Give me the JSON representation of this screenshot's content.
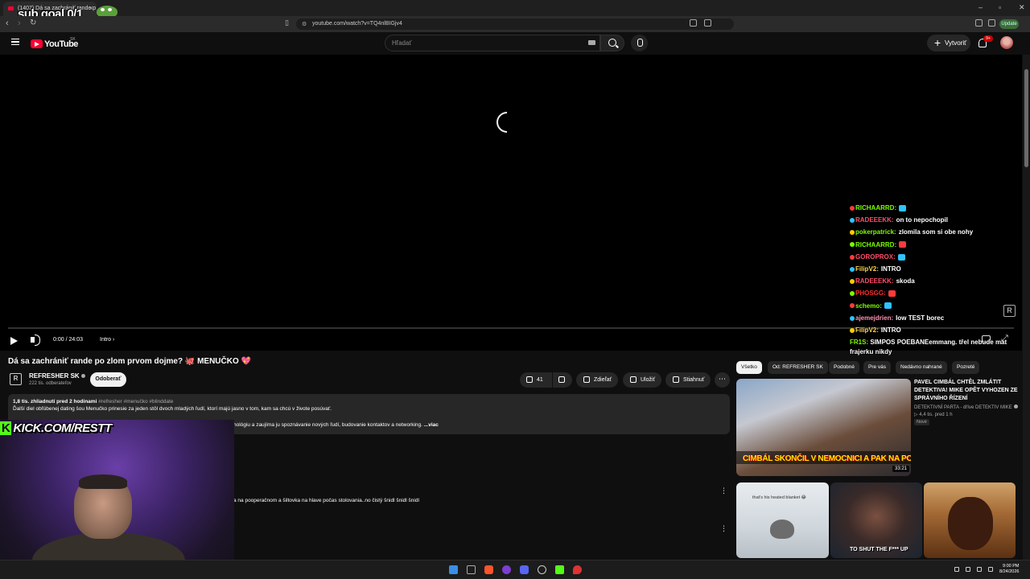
{
  "browser": {
    "tab_title": "(1407) Dá sa zachrániť rande p",
    "overlay_subgoal": "sub goal 0/1",
    "url": "youtube.com/watch?v=TQ4nlBIGjv4",
    "update_label": "Update"
  },
  "header": {
    "logo_text": "YouTube",
    "country_code": "SK",
    "search_placeholder": "Hľadať",
    "create_label": "Vytvoriť",
    "notif_count": "9+"
  },
  "player": {
    "time": "0:00 / 24:03",
    "chapter": "Intro"
  },
  "chat": {
    "colors": {
      "red": "#ff4d4d",
      "green": "#7cfc00",
      "yellow": "#ffd34d",
      "blue": "#5fb0ff"
    },
    "messages": [
      {
        "user": "RICHAARRD:",
        "color": "#7cfc00",
        "text": ""
      },
      {
        "user": "RADEEEKK:",
        "color": "#ff4d6a",
        "text": "on to nepochopil"
      },
      {
        "user": "pokerpatrick:",
        "color": "#7cfc00",
        "text": "zlomila som si obe nohy"
      },
      {
        "user": "RICHAARRD:",
        "color": "#7cfc00",
        "text": ""
      },
      {
        "user": "GOROPROX:",
        "color": "#ff4d6a",
        "text": ""
      },
      {
        "user": "FilipV2:",
        "color": "#ffd34d",
        "text": "INTRO"
      },
      {
        "user": "RADEEEKK:",
        "color": "#ff4d6a",
        "text": "skoda"
      },
      {
        "user": "PHOSGG:",
        "color": "#ff2d2d",
        "text": ""
      },
      {
        "user": "schemo:",
        "color": "#7cfc00",
        "text": ""
      },
      {
        "user": "ajemejdrien:",
        "color": "#ff8fb0",
        "text": "low TEST borec"
      },
      {
        "user": "FilipV2:",
        "color": "#ffd34d",
        "text": "INTRO"
      }
    ],
    "last_message": {
      "user": "FR1S:",
      "text": "SIMPOS POEBANEemmang. třel nebude mat frajerku nikdy"
    }
  },
  "video": {
    "title": "Dá sa zachrániť rande po zlom prvom dojme? 🐙 MENUČKO 💖",
    "channel": "REFRESHER SK",
    "subscribers": "222 tis. odberateľov",
    "subscribe_label": "Odoberať",
    "likes": "41",
    "share_label": "Zdieľať",
    "save_label": "Uložiť",
    "download_label": "Stiahnuť",
    "views_time": "1,8 tis. zhliadnutí  pred 2 hodinami",
    "hashtags": "#refresher #menučko #blinddate",
    "desc_line1": "Ďalší diel obľúbenej dating šou Menučko prinesie za jeden stôl dvoch mladých ľudí, ktorí majú jasno v tom, kam sa chcú v živote posúvať.",
    "desc_line2": "hológiu a zaujíma ju spoznávanie nových ľudí, budovanie kontaktov a networking.",
    "more_label": "...viac",
    "comment_snippet": "a na pooperačnom a šiltovka na hlave počas stolovania..no čistý šnidl šnidl šnidl"
  },
  "overlay": {
    "kick_text": "KICK.COM/RESTT"
  },
  "sidebar": {
    "chips": [
      "Všetko",
      "Od: REFRESHER SK",
      "Podobné",
      "Pre vás",
      "Nedávno nahrané",
      "Pozreté"
    ],
    "rec1": {
      "title": "PAVEL CIMBÁL CHTĚL ZMLÁTIT DETEKTIVA! MIKE OPĚT VYHOZEN ZE SPRÁVNÍHO ŘÍZENÍ",
      "channel": "DETEKTIVNÍ PARTA - dříve DETEKTIV MIKE",
      "meta": "▷ 4,4 tis.  pred 1 h",
      "badge": "Nové",
      "thumb_text": "CIMBÁL SKONČIL V NEMOCNICI A PAK NA POLICII",
      "duration": "33:21"
    },
    "short1_text": "that's his heated blanket 😂",
    "short2_text": "TO SHUT THE F*** UP"
  },
  "taskbar": {
    "time": "9:00 PM",
    "date": "8/24/2026"
  }
}
